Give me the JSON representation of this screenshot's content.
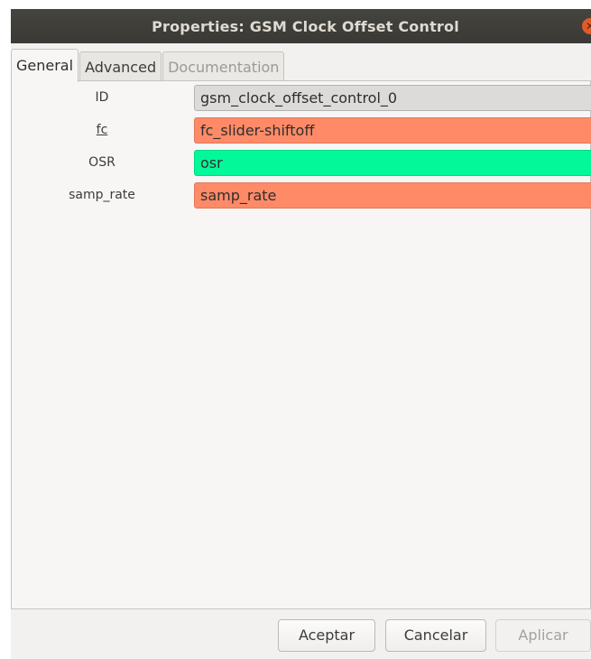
{
  "window": {
    "title": "Properties: GSM Clock Offset Control",
    "close_icon": "close-icon"
  },
  "tabs": [
    {
      "label": "General",
      "active": true,
      "enabled": true
    },
    {
      "label": "Advanced",
      "active": false,
      "enabled": true
    },
    {
      "label": "Documentation",
      "active": false,
      "enabled": false
    }
  ],
  "params": [
    {
      "label": "ID",
      "value": "gsm_clock_offset_control_0",
      "color": "#dcdbd9"
    },
    {
      "label": "fc",
      "value": "fc_slider-shiftoff",
      "color": "#fe8a68"
    },
    {
      "label": "OSR",
      "value": "osr",
      "color": "#03f89a"
    },
    {
      "label": "samp_rate",
      "value": "samp_rate",
      "color": "#fe8a68"
    }
  ],
  "buttons": {
    "accept": "Aceptar",
    "cancel": "Cancelar",
    "apply": "Aplicar"
  }
}
